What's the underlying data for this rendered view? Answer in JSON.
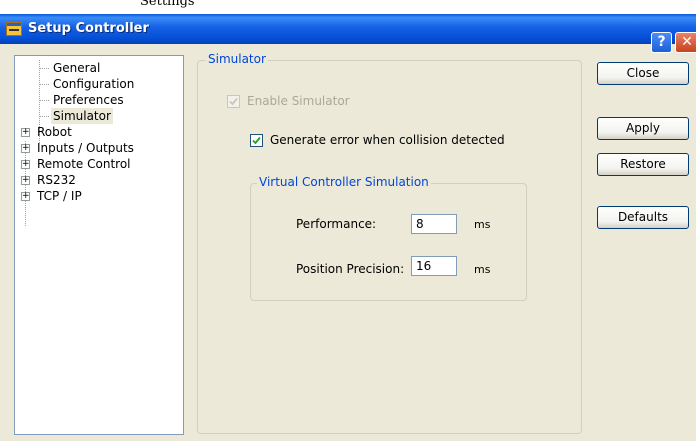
{
  "background_caption": "Settings",
  "window": {
    "title": "Setup Controller"
  },
  "titlebar": {
    "help_glyph": "?",
    "close_glyph": "✕"
  },
  "tree": {
    "items": [
      {
        "label": "General",
        "expandable": false
      },
      {
        "label": "Configuration",
        "expandable": false
      },
      {
        "label": "Preferences",
        "expandable": false
      },
      {
        "label": "Simulator",
        "expandable": false,
        "selected": true
      },
      {
        "label": "Robot",
        "expandable": true
      },
      {
        "label": "Inputs / Outputs",
        "expandable": true
      },
      {
        "label": "Remote Control",
        "expandable": true
      },
      {
        "label": "RS232",
        "expandable": true
      },
      {
        "label": "TCP / IP",
        "expandable": true
      }
    ]
  },
  "simulator": {
    "legend": "Simulator",
    "enable_simulator": {
      "label": "Enable Simulator",
      "checked": true,
      "disabled": true
    },
    "generate_error": {
      "label": "Generate error when collision detected",
      "checked": true
    },
    "vcs": {
      "legend": "Virtual Controller Simulation",
      "performance": {
        "label": "Performance:",
        "value": "8",
        "unit": "ms"
      },
      "position_precision": {
        "label": "Position Precision:",
        "value": "16",
        "unit": "ms"
      }
    }
  },
  "buttons": {
    "close": "Close",
    "apply": "Apply",
    "restore": "Restore",
    "defaults": "Defaults"
  },
  "colors": {
    "titlebar": "#0a5ce0",
    "dialog_bg": "#ece9d8",
    "group_legend": "#0046d5",
    "checkbox_check": "#21a121"
  }
}
